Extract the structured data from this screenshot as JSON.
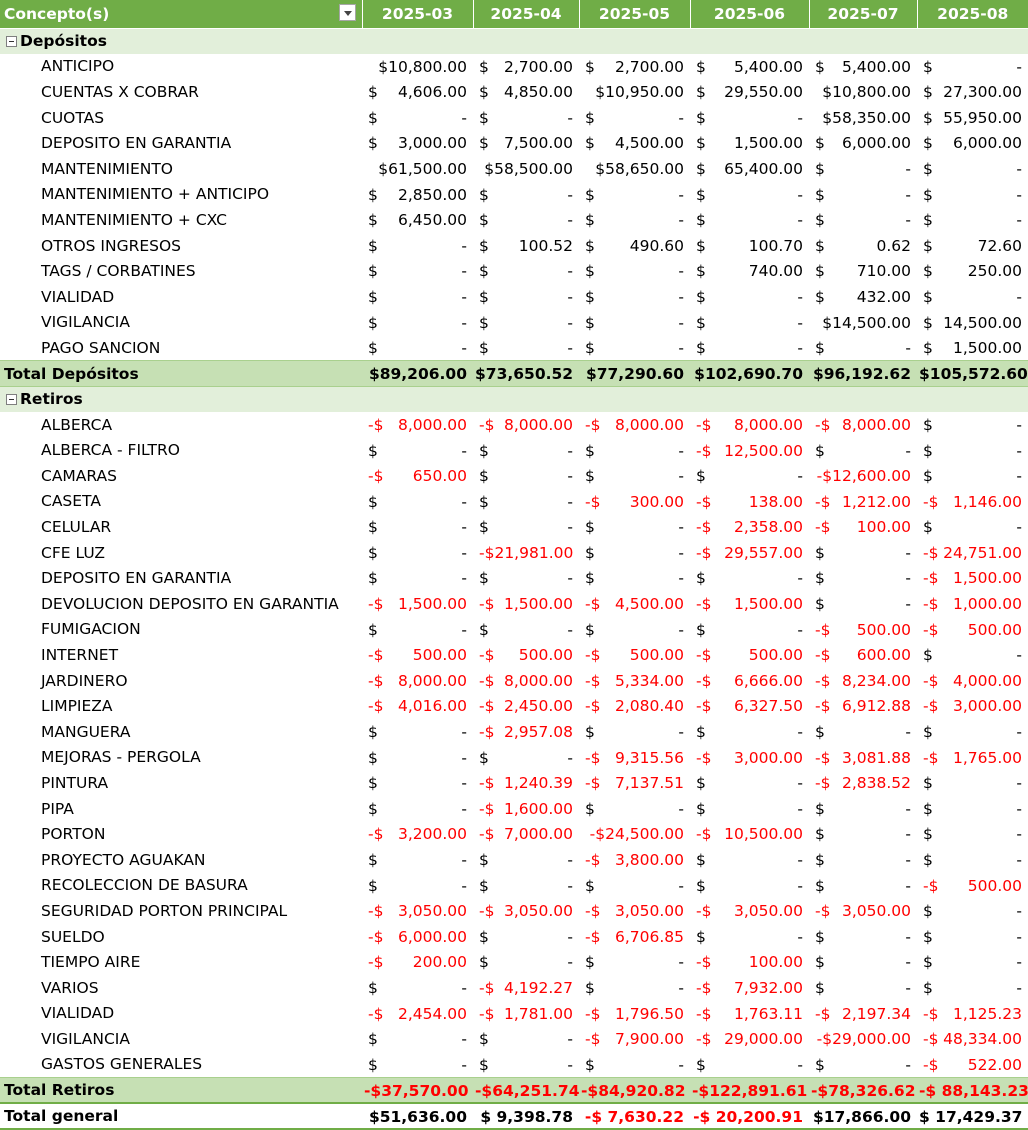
{
  "header": {
    "concept_label": "Concepto(s)",
    "months": [
      "2025-03",
      "2025-04",
      "2025-05",
      "2025-06",
      "2025-07",
      "2025-08"
    ]
  },
  "groups": [
    {
      "name": "Depósitos",
      "rows": [
        {
          "label": "ANTICIPO",
          "values": [
            "$10,800.00",
            "$ 2,700.00",
            "$ 2,700.00",
            "$ 5,400.00",
            "$ 5,400.00",
            "$ -"
          ]
        },
        {
          "label": "CUENTAS X COBRAR",
          "values": [
            "$ 4,606.00",
            "$ 4,850.00",
            "$10,950.00",
            "$ 29,550.00",
            "$10,800.00",
            "$ 27,300.00"
          ]
        },
        {
          "label": "CUOTAS",
          "values": [
            "$ -",
            "$ -",
            "$ -",
            "$ -",
            "$58,350.00",
            "$ 55,950.00"
          ]
        },
        {
          "label": "DEPOSITO EN GARANTIA",
          "values": [
            "$ 3,000.00",
            "$ 7,500.00",
            "$ 4,500.00",
            "$ 1,500.00",
            "$ 6,000.00",
            "$ 6,000.00"
          ]
        },
        {
          "label": "MANTENIMIENTO",
          "values": [
            "$61,500.00",
            "$58,500.00",
            "$58,650.00",
            "$ 65,400.00",
            "$ -",
            "$ -"
          ]
        },
        {
          "label": "MANTENIMIENTO + ANTICIPO",
          "values": [
            "$ 2,850.00",
            "$ -",
            "$ -",
            "$ -",
            "$ -",
            "$ -"
          ]
        },
        {
          "label": "MANTENIMIENTO + CXC",
          "values": [
            "$ 6,450.00",
            "$ -",
            "$ -",
            "$ -",
            "$ -",
            "$ -"
          ]
        },
        {
          "label": "OTROS INGRESOS",
          "values": [
            "$ -",
            "$ 100.52",
            "$ 490.60",
            "$ 100.70",
            "$ 0.62",
            "$ 72.60"
          ]
        },
        {
          "label": "TAGS / CORBATINES",
          "values": [
            "$ -",
            "$ -",
            "$ -",
            "$ 740.00",
            "$ 710.00",
            "$ 250.00"
          ]
        },
        {
          "label": "VIALIDAD",
          "values": [
            "$ -",
            "$ -",
            "$ -",
            "$ -",
            "$ 432.00",
            "$ -"
          ]
        },
        {
          "label": "VIGILANCIA",
          "values": [
            "$ -",
            "$ -",
            "$ -",
            "$ -",
            "$14,500.00",
            "$ 14,500.00"
          ]
        },
        {
          "label": "PAGO SANCION",
          "values": [
            "$ -",
            "$ -",
            "$ -",
            "$ -",
            "$ -",
            "$ 1,500.00"
          ]
        }
      ],
      "total_label": "Total Depósitos",
      "totals": [
        "$89,206.00",
        "$73,650.52",
        "$77,290.60",
        "$102,690.70",
        "$96,192.62",
        "$105,572.60"
      ]
    },
    {
      "name": "Retiros",
      "rows": [
        {
          "label": "ALBERCA",
          "values": [
            "-$ 8,000.00",
            "-$ 8,000.00",
            "-$ 8,000.00",
            "-$ 8,000.00",
            "-$ 8,000.00",
            "$ -"
          ]
        },
        {
          "label": "ALBERCA - FILTRO",
          "values": [
            "$ -",
            "$ -",
            "$ -",
            "-$ 12,500.00",
            "$ -",
            "$ -"
          ]
        },
        {
          "label": "CAMARAS",
          "values": [
            "-$ 650.00",
            "$ -",
            "$ -",
            "$ -",
            "-$12,600.00",
            "$ -"
          ]
        },
        {
          "label": "CASETA",
          "values": [
            "$ -",
            "$ -",
            "-$ 300.00",
            "-$ 138.00",
            "-$ 1,212.00",
            "-$ 1,146.00"
          ]
        },
        {
          "label": "CELULAR",
          "values": [
            "$ -",
            "$ -",
            "$ -",
            "-$ 2,358.00",
            "-$ 100.00",
            "$ -"
          ]
        },
        {
          "label": "CFE LUZ",
          "values": [
            "$ -",
            "-$21,981.00",
            "$ -",
            "-$ 29,557.00",
            "$ -",
            "-$ 24,751.00"
          ]
        },
        {
          "label": "DEPOSITO EN GARANTIA",
          "values": [
            "$ -",
            "$ -",
            "$ -",
            "$ -",
            "$ -",
            "-$ 1,500.00"
          ]
        },
        {
          "label": "DEVOLUCION DEPOSITO EN GARANTIA",
          "values": [
            "-$ 1,500.00",
            "-$ 1,500.00",
            "-$ 4,500.00",
            "-$ 1,500.00",
            "$ -",
            "-$ 1,000.00"
          ]
        },
        {
          "label": "FUMIGACION",
          "values": [
            "$ -",
            "$ -",
            "$ -",
            "$ -",
            "-$ 500.00",
            "-$ 500.00"
          ]
        },
        {
          "label": "INTERNET",
          "values": [
            "-$ 500.00",
            "-$ 500.00",
            "-$ 500.00",
            "-$ 500.00",
            "-$ 600.00",
            "$ -"
          ]
        },
        {
          "label": "JARDINERO",
          "values": [
            "-$ 8,000.00",
            "-$ 8,000.00",
            "-$ 5,334.00",
            "-$ 6,666.00",
            "-$ 8,234.00",
            "-$ 4,000.00"
          ]
        },
        {
          "label": "LIMPIEZA",
          "values": [
            "-$ 4,016.00",
            "-$ 2,450.00",
            "-$ 2,080.40",
            "-$ 6,327.50",
            "-$ 6,912.88",
            "-$ 3,000.00"
          ]
        },
        {
          "label": "MANGUERA",
          "values": [
            "$ -",
            "-$ 2,957.08",
            "$ -",
            "$ -",
            "$ -",
            "$ -"
          ]
        },
        {
          "label": "MEJORAS - PERGOLA",
          "values": [
            "$ -",
            "$ -",
            "-$ 9,315.56",
            "-$ 3,000.00",
            "-$ 3,081.88",
            "-$ 1,765.00"
          ]
        },
        {
          "label": "PINTURA",
          "values": [
            "$ -",
            "-$ 1,240.39",
            "-$ 7,137.51",
            "$ -",
            "-$ 2,838.52",
            "$ -"
          ]
        },
        {
          "label": "PIPA",
          "values": [
            "$ -",
            "-$ 1,600.00",
            "$ -",
            "$ -",
            "$ -",
            "$ -"
          ]
        },
        {
          "label": "PORTON",
          "values": [
            "-$ 3,200.00",
            "-$ 7,000.00",
            "-$24,500.00",
            "-$ 10,500.00",
            "$ -",
            "$ -"
          ]
        },
        {
          "label": "PROYECTO AGUAKAN",
          "values": [
            "$ -",
            "$ -",
            "-$ 3,800.00",
            "$ -",
            "$ -",
            "$ -"
          ]
        },
        {
          "label": "RECOLECCION DE BASURA",
          "values": [
            "$ -",
            "$ -",
            "$ -",
            "$ -",
            "$ -",
            "-$ 500.00"
          ]
        },
        {
          "label": "SEGURIDAD PORTON PRINCIPAL",
          "values": [
            "-$ 3,050.00",
            "-$ 3,050.00",
            "-$ 3,050.00",
            "-$ 3,050.00",
            "-$ 3,050.00",
            "$ -"
          ]
        },
        {
          "label": "SUELDO",
          "values": [
            "-$ 6,000.00",
            "$ -",
            "-$ 6,706.85",
            "$ -",
            "$ -",
            "$ -"
          ]
        },
        {
          "label": "TIEMPO AIRE",
          "values": [
            "-$ 200.00",
            "$ -",
            "$ -",
            "-$ 100.00",
            "$ -",
            "$ -"
          ]
        },
        {
          "label": "VARIOS",
          "values": [
            "$ -",
            "-$ 4,192.27",
            "$ -",
            "-$ 7,932.00",
            "$ -",
            "$ -"
          ]
        },
        {
          "label": "VIALIDAD",
          "values": [
            "-$ 2,454.00",
            "-$ 1,781.00",
            "-$ 1,796.50",
            "-$ 1,763.11",
            "-$ 2,197.34",
            "-$ 1,125.23"
          ]
        },
        {
          "label": "VIGILANCIA",
          "values": [
            "$ -",
            "$ -",
            "-$ 7,900.00",
            "-$ 29,000.00",
            "-$29,000.00",
            "-$ 48,334.00"
          ]
        },
        {
          "label": "GASTOS GENERALES",
          "values": [
            "$ -",
            "$ -",
            "$ -",
            "$ -",
            "$ -",
            "-$ 522.00"
          ]
        }
      ],
      "total_label": "Total Retiros",
      "totals": [
        "-$37,570.00",
        "-$64,251.74",
        "-$84,920.82",
        "-$122,891.61",
        "-$78,326.62",
        "-$ 88,143.23"
      ]
    }
  ],
  "grand_total": {
    "label": "Total general",
    "values": [
      "$51,636.00",
      "$ 9,398.78",
      "-$ 7,630.22",
      "-$ 20,200.91",
      "$17,866.00",
      "$ 17,429.37"
    ]
  },
  "colors": {
    "header_bg": "#70ad47",
    "group_bg": "#e2efda",
    "total_bg": "#c6e0b4",
    "negative": "#ff0000"
  },
  "icons": {
    "filter_dropdown": "chevron-down-icon",
    "collapse": "minus-box-icon"
  }
}
